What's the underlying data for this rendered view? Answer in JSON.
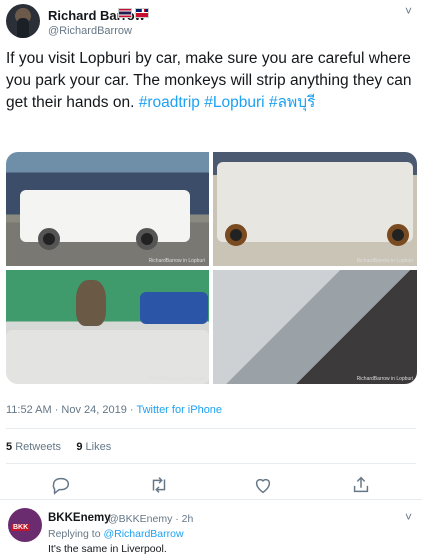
{
  "tweet": {
    "author_name": "Richard Barrow",
    "author_handle": "@RichardBarrow",
    "text_plain": "If you visit Lopburi by car, make sure you are careful where you park your car. The monkeys will strip anything they can get their hands on. ",
    "hashtags": [
      "#roadtrip",
      "#Lopburi",
      "#ลพบุรี"
    ],
    "timestamp": "11:52 AM · Nov 24, 2019 · ",
    "source": "Twitter for iPhone",
    "retweets_count": "5",
    "retweets_label": "Retweets",
    "likes_count": "9",
    "likes_label": "Likes",
    "caret": "˅",
    "photo_credit": "RichardBarrow in Lopburi"
  },
  "reply": {
    "author_name": "BKKEnemy",
    "author_handle": "@BKKEnemy · 2h",
    "replying_prefix": "Replying to ",
    "replying_to": "@RichardBarrow",
    "text": "It's the same in Liverpool.",
    "caret": "˅",
    "avatar_text": "BKK"
  },
  "icons": [
    "reply-icon",
    "retweet-icon",
    "like-icon",
    "share-icon"
  ],
  "colors": {
    "link": "#1da1f2",
    "muted": "#657786",
    "text": "#14171a"
  }
}
